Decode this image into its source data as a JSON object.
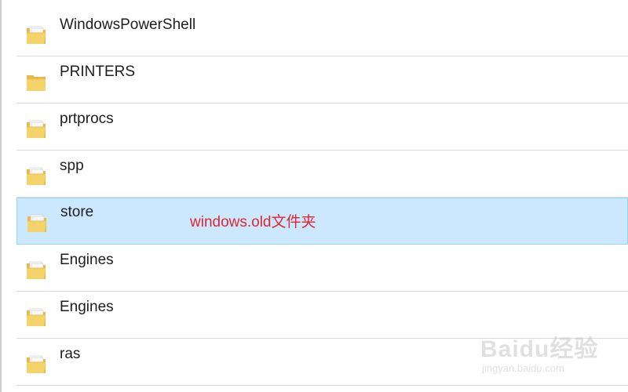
{
  "folders": [
    {
      "name": "WindowsPowerShell",
      "icon": "folder-with-pages-icon",
      "selected": false
    },
    {
      "name": "PRINTERS",
      "icon": "folder-icon",
      "selected": false
    },
    {
      "name": "prtprocs",
      "icon": "folder-with-pages-icon",
      "selected": false
    },
    {
      "name": "spp",
      "icon": "folder-with-pages-icon",
      "selected": false
    },
    {
      "name": "store",
      "icon": "folder-with-pages-icon",
      "selected": true
    },
    {
      "name": "Engines",
      "icon": "folder-with-pages-icon",
      "selected": false
    },
    {
      "name": "Engines",
      "icon": "folder-with-pages-icon",
      "selected": false
    },
    {
      "name": "ras",
      "icon": "folder-with-pages-icon",
      "selected": false
    }
  ],
  "annotation": {
    "text": "windows.old文件夹",
    "color": "#e0262f"
  },
  "watermark": {
    "brand": "Baidu经验",
    "url": "jingyan.baidu.com"
  },
  "colors": {
    "selection_bg": "#cce8ff",
    "selection_border": "#99d1ff",
    "folder_yellow": "#f5d36b"
  }
}
